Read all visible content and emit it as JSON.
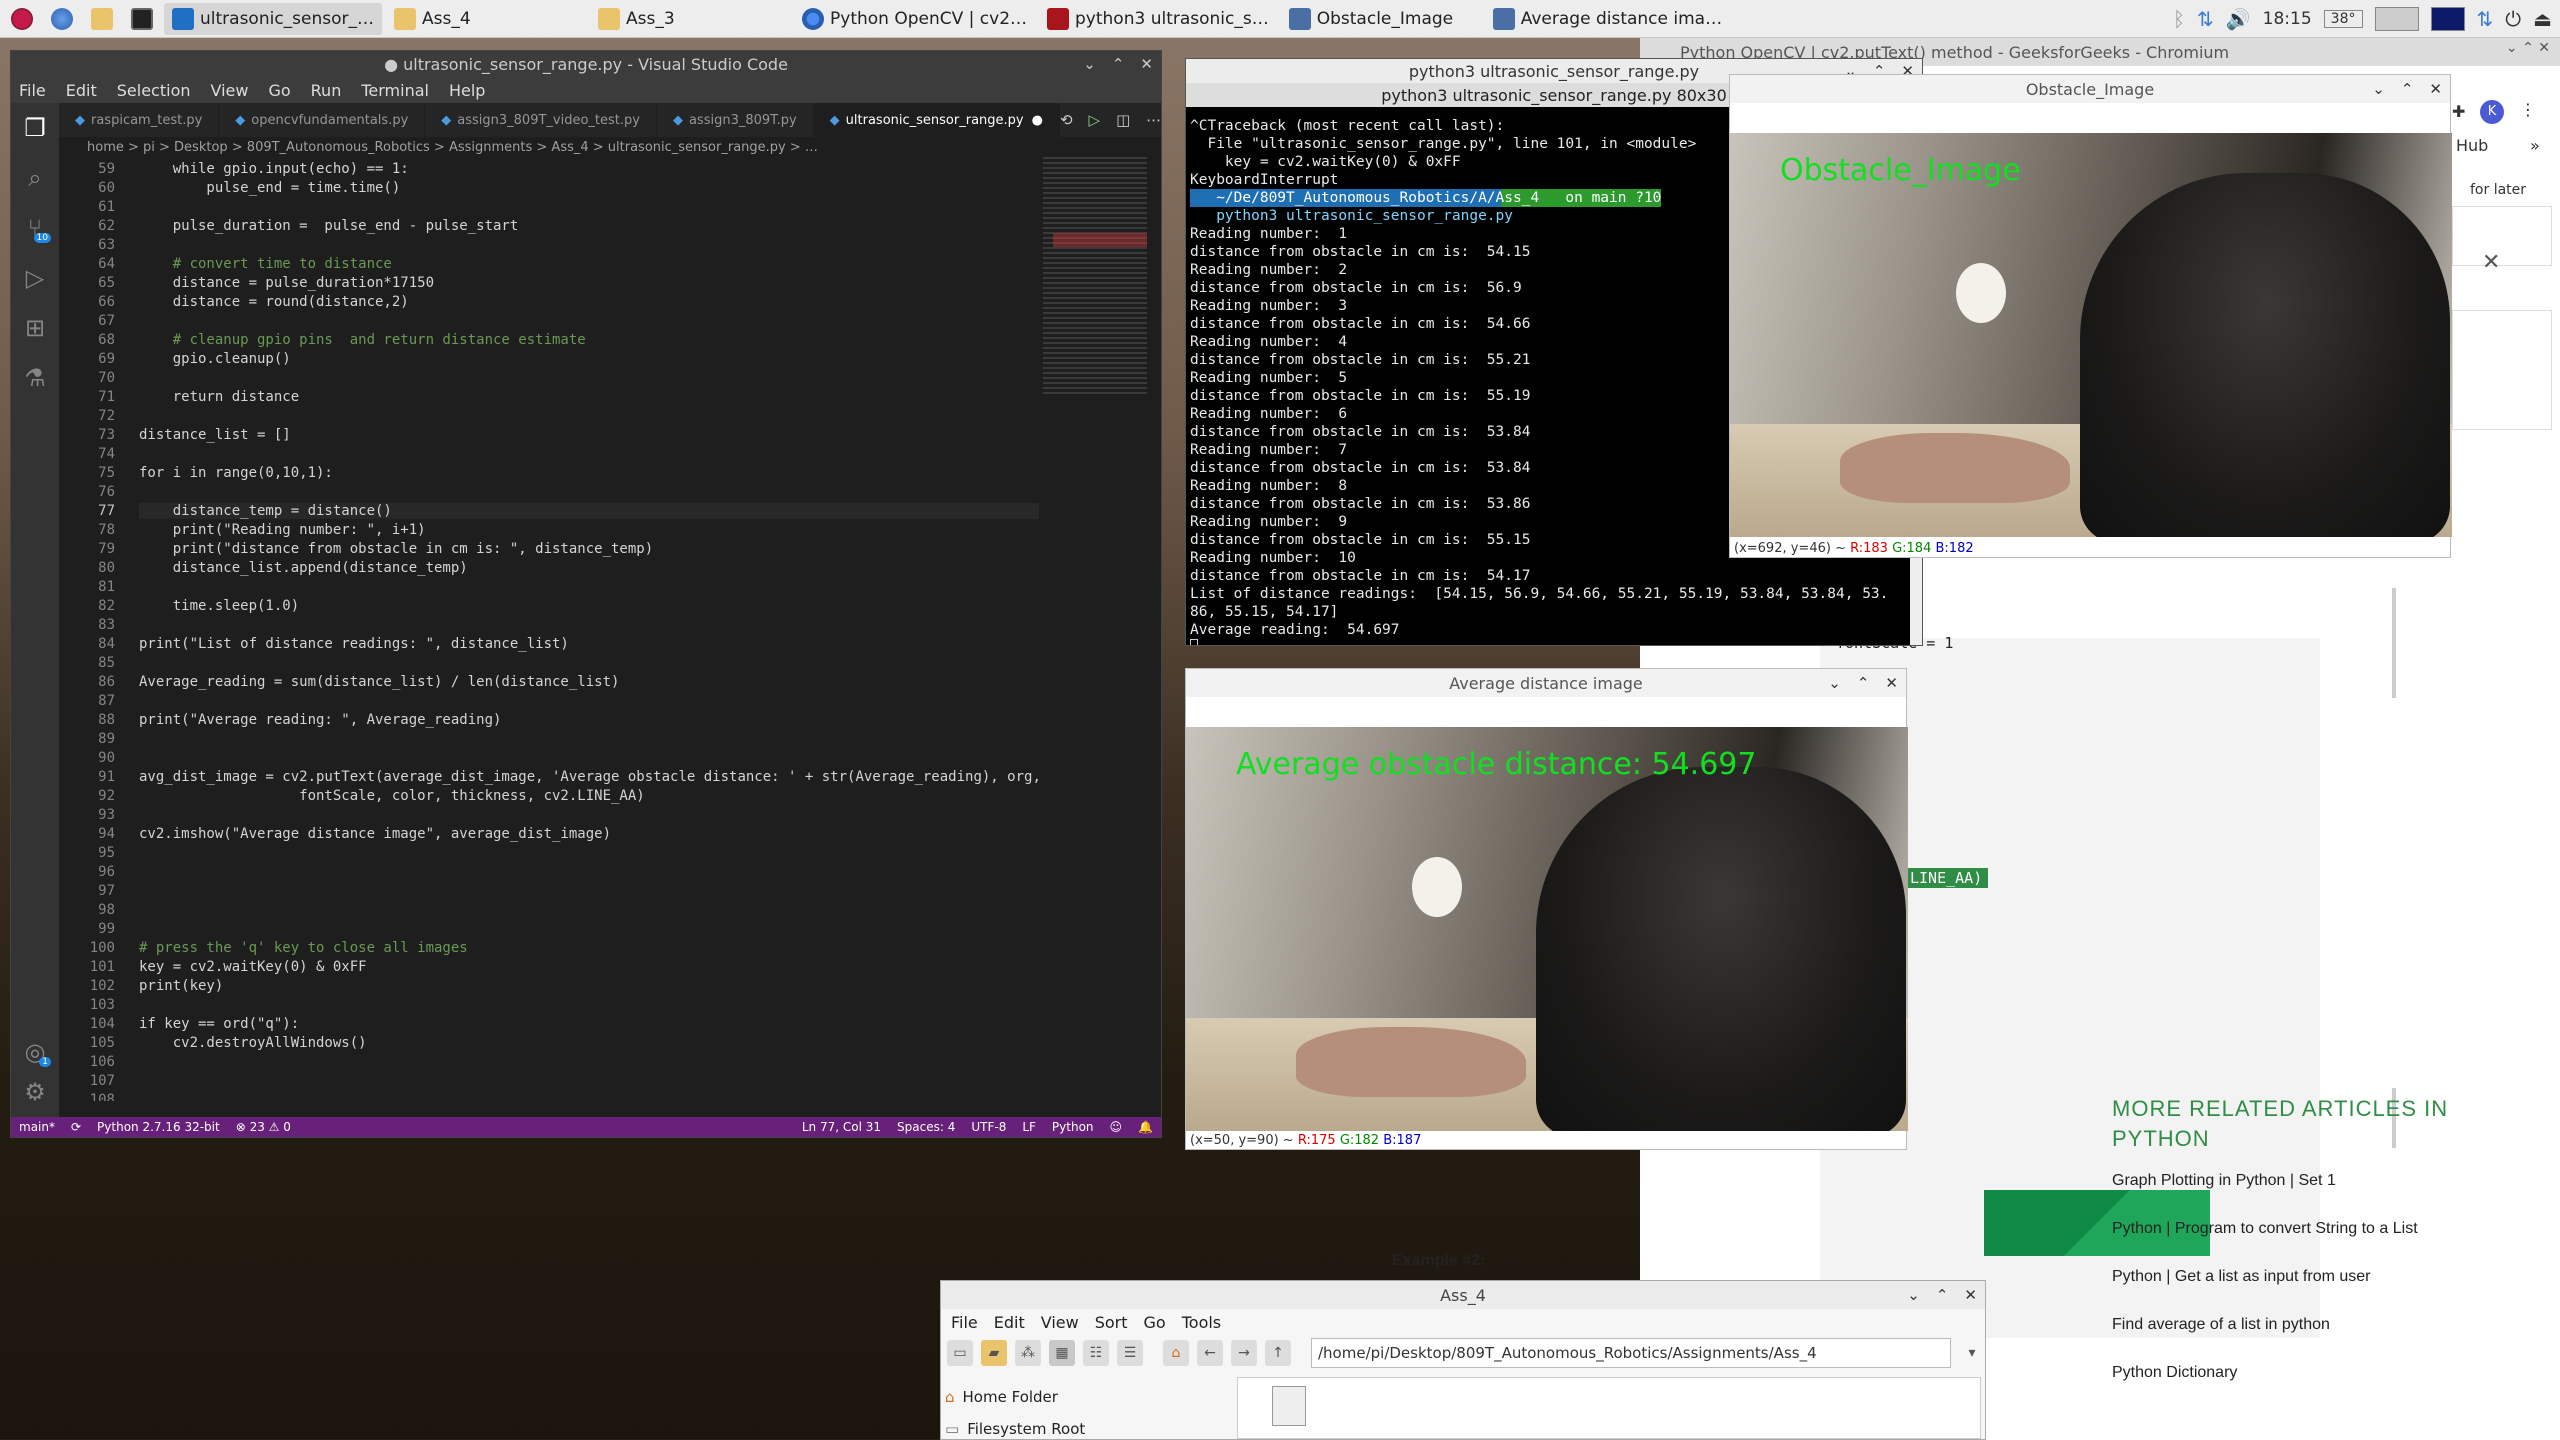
{
  "taskbar": {
    "tasks": [
      {
        "label": "ultrasonic_sensor_…"
      },
      {
        "label": "Ass_4"
      },
      {
        "label": "Ass_3"
      },
      {
        "label": "Python OpenCV | cv2…"
      },
      {
        "label": "python3 ultrasonic_s…"
      },
      {
        "label": "Obstacle_Image"
      },
      {
        "label": "Average distance ima…"
      }
    ],
    "clock": "18:15",
    "temperature": "38°"
  },
  "browser": {
    "title": "Python OpenCV | cv2.putText() method - GeeksforGeeks - Chromium",
    "hub_label": "Hub",
    "later_label": "for later",
    "code_fragment_1": "fontScale = 1",
    "code_fragment_2": "LINE_AA)",
    "example_label": "Example #2:",
    "related_heading": "MORE RELATED ARTICLES IN PYTHON",
    "related_links": [
      "Graph Plotting in Python | Set 1",
      "Python | Program to convert String to a List",
      "Python | Get a list as input from user",
      "Find average of a list in python",
      "Python Dictionary"
    ],
    "avatar_letter": "K"
  },
  "vscode": {
    "title": "● ultrasonic_sensor_range.py - Visual Studio Code",
    "menu": [
      "File",
      "Edit",
      "Selection",
      "View",
      "Go",
      "Run",
      "Terminal",
      "Help"
    ],
    "tabs": [
      "raspicam_test.py",
      "opencvfundamentals.py",
      "assign3_809T_video_test.py",
      "assign3_809T.py",
      "ultrasonic_sensor_range.py"
    ],
    "breadcrumb": "home > pi > Desktop > 809T_Autonomous_Robotics > Assignments > Ass_4 > ultrasonic_sensor_range.py > …",
    "lines": [
      {
        "n": "59",
        "t": "    while gpio.input(echo) == 1:"
      },
      {
        "n": "60",
        "t": "        pulse_end = time.time()"
      },
      {
        "n": "61",
        "t": ""
      },
      {
        "n": "62",
        "t": "    pulse_duration =  pulse_end - pulse_start"
      },
      {
        "n": "63",
        "t": ""
      },
      {
        "n": "64",
        "t": "    # convert time to distance"
      },
      {
        "n": "65",
        "t": "    distance = pulse_duration*17150"
      },
      {
        "n": "66",
        "t": "    distance = round(distance,2)"
      },
      {
        "n": "67",
        "t": ""
      },
      {
        "n": "68",
        "t": "    # cleanup gpio pins  and return distance estimate"
      },
      {
        "n": "69",
        "t": "    gpio.cleanup()"
      },
      {
        "n": "70",
        "t": ""
      },
      {
        "n": "71",
        "t": "    return distance"
      },
      {
        "n": "72",
        "t": ""
      },
      {
        "n": "73",
        "t": "distance_list = []"
      },
      {
        "n": "74",
        "t": ""
      },
      {
        "n": "75",
        "t": "for i in range(0,10,1):"
      },
      {
        "n": "76",
        "t": ""
      },
      {
        "n": "77",
        "t": "    distance_temp = distance()"
      },
      {
        "n": "78",
        "t": "    print(\"Reading number: \", i+1)"
      },
      {
        "n": "79",
        "t": "    print(\"distance from obstacle in cm is: \", distance_temp)"
      },
      {
        "n": "80",
        "t": "    distance_list.append(distance_temp)"
      },
      {
        "n": "81",
        "t": ""
      },
      {
        "n": "82",
        "t": "    time.sleep(1.0)"
      },
      {
        "n": "83",
        "t": ""
      },
      {
        "n": "84",
        "t": "print(\"List of distance readings: \", distance_list)"
      },
      {
        "n": "85",
        "t": ""
      },
      {
        "n": "86",
        "t": "Average_reading = sum(distance_list) / len(distance_list)"
      },
      {
        "n": "87",
        "t": ""
      },
      {
        "n": "88",
        "t": "print(\"Average reading: \", Average_reading)"
      },
      {
        "n": "89",
        "t": ""
      },
      {
        "n": "90",
        "t": ""
      },
      {
        "n": "91",
        "t": "avg_dist_image = cv2.putText(average_dist_image, 'Average obstacle distance: ' + str(Average_reading), org,"
      },
      {
        "n": "92",
        "t": "                   fontScale, color, thickness, cv2.LINE_AA)"
      },
      {
        "n": "93",
        "t": ""
      },
      {
        "n": "94",
        "t": "cv2.imshow(\"Average distance image\", average_dist_image)"
      },
      {
        "n": "95",
        "t": ""
      },
      {
        "n": "96",
        "t": ""
      },
      {
        "n": "97",
        "t": ""
      },
      {
        "n": "98",
        "t": ""
      },
      {
        "n": "99",
        "t": ""
      },
      {
        "n": "100",
        "t": "# press the 'q' key to close all images"
      },
      {
        "n": "101",
        "t": "key = cv2.waitKey(0) & 0xFF"
      },
      {
        "n": "102",
        "t": "print(key)"
      },
      {
        "n": "103",
        "t": ""
      },
      {
        "n": "104",
        "t": "if key == ord(\"q\"):"
      },
      {
        "n": "105",
        "t": "    cv2.destroyAllWindows()"
      },
      {
        "n": "106",
        "t": ""
      },
      {
        "n": "107",
        "t": ""
      },
      {
        "n": "108",
        "t": ""
      }
    ],
    "status": {
      "branch": "main*",
      "python": "Python 2.7.16 32-bit",
      "problems": "⊗ 23 ⚠ 0",
      "position": "Ln 77, Col 31",
      "spaces": "Spaces: 4",
      "encoding": "UTF-8",
      "eol": "LF",
      "language": "Python"
    },
    "source_control_badge": "10",
    "accounts_badge": "1"
  },
  "terminal": {
    "title": "python3 ultrasonic_sensor_range.py",
    "subtitle": "python3 ultrasonic_sensor_range.py 80x30",
    "lines": [
      "^CTraceback (most recent call last):",
      "  File \"ultrasonic_sensor_range.py\", line 101, in <module>",
      "    key = cv2.waitKey(0) & 0xFF",
      "KeyboardInterrupt",
      "   ~/De/809T_Autonomous_Robotics/A/Ass_4   on main ?10",
      "   python3 ultrasonic_sensor_range.py",
      "Reading number:  1",
      "distance from obstacle in cm is:  54.15",
      "Reading number:  2",
      "distance from obstacle in cm is:  56.9",
      "Reading number:  3",
      "distance from obstacle in cm is:  54.66",
      "Reading number:  4",
      "distance from obstacle in cm is:  55.21",
      "Reading number:  5",
      "distance from obstacle in cm is:  55.19",
      "Reading number:  6",
      "distance from obstacle in cm is:  53.84",
      "Reading number:  7",
      "distance from obstacle in cm is:  53.84",
      "Reading number:  8",
      "distance from obstacle in cm is:  53.86",
      "Reading number:  9",
      "distance from obstacle in cm is:  55.15",
      "Reading number:  10",
      "distance from obstacle in cm is:  54.17",
      "List of distance readings:  [54.15, 56.9, 54.66, 55.21, 55.19, 53.84, 53.84, 53.",
      "86, 55.15, 54.17]",
      "Average reading:  54.697"
    ]
  },
  "obstacle_window": {
    "title": "Obstacle_Image",
    "overlay": "Obstacle_Image",
    "coords_prefix": "(x=692, y=46) ~",
    "r": "R:183",
    "g": "G:184",
    "b": "B:182"
  },
  "average_window": {
    "title": "Average distance image",
    "overlay": "Average obstacle distance: 54.697",
    "coords_prefix": "(x=50, y=90) ~",
    "r": "R:175",
    "g": "G:182",
    "b": "B:187"
  },
  "filemanager": {
    "title": "Ass_4",
    "menu": [
      "File",
      "Edit",
      "View",
      "Sort",
      "Go",
      "Tools"
    ],
    "path": "/home/pi/Desktop/809T_Autonomous_Robotics/Assignments/Ass_4",
    "places": [
      "Home Folder",
      "Filesystem Root"
    ]
  },
  "colors": {
    "overlay_green": "#10e020",
    "vscode_status": "#68217a",
    "gfg_green": "#2f8d46"
  }
}
